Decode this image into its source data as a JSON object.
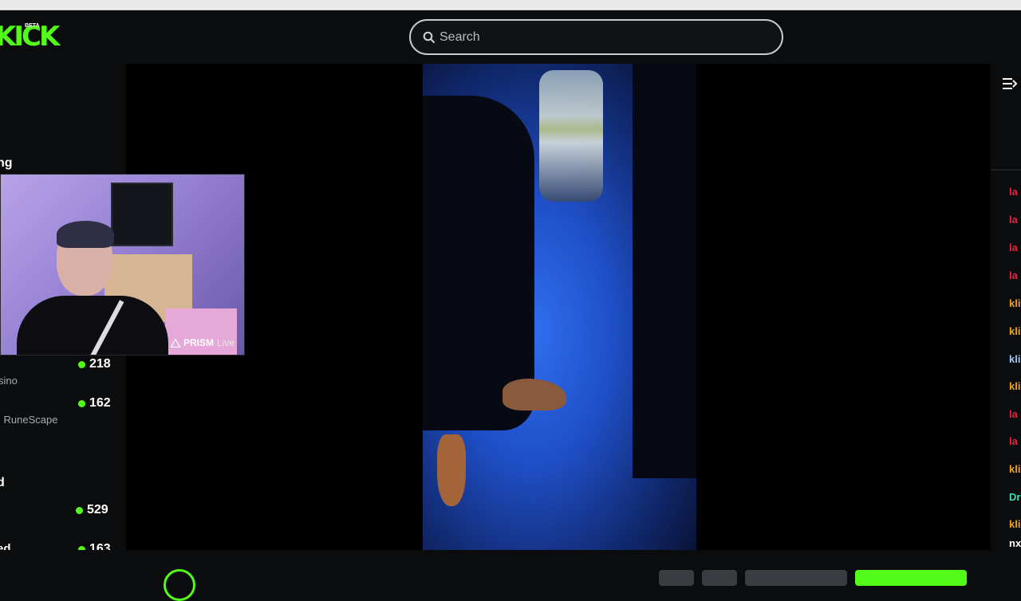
{
  "header": {
    "logo_text": "KICK",
    "logo_badge": "BETA",
    "search_placeholder": "Search"
  },
  "sidebar": {
    "section_heading": "ng",
    "channels": [
      {
        "category": "sino",
        "viewers": "218"
      },
      {
        "category": "l RuneScape",
        "viewers": "162"
      }
    ],
    "section_heading_2": "d",
    "channels_2": [
      {
        "category": "",
        "viewers": "529"
      },
      {
        "category": "ed",
        "viewers": "163"
      }
    ]
  },
  "camera_overlay": {
    "badge_name": "PRISM",
    "badge_suffix": "Live"
  },
  "chat": {
    "users": [
      {
        "name": "la",
        "color": "#e5243f"
      },
      {
        "name": "la",
        "color": "#e5243f"
      },
      {
        "name": "la",
        "color": "#e5243f"
      },
      {
        "name": "la",
        "color": "#e5243f"
      },
      {
        "name": "kli",
        "color": "#f0a31b"
      },
      {
        "name": "kli",
        "color": "#f0a31b"
      },
      {
        "name": "kli",
        "color": "#9ec7f5"
      },
      {
        "name": "kli",
        "color": "#f0a31b"
      },
      {
        "name": "la",
        "color": "#e5243f"
      },
      {
        "name": "la",
        "color": "#e5243f"
      },
      {
        "name": "kli",
        "color": "#f0a31b"
      },
      {
        "name": "Dr",
        "color": "#3fdcb0"
      },
      {
        "name": "kli",
        "color": "#f0a31b"
      },
      {
        "name": "nx",
        "color": "#ffffff"
      }
    ]
  },
  "colors": {
    "brand_green": "#53fc18",
    "background": "#0b0c0e"
  }
}
